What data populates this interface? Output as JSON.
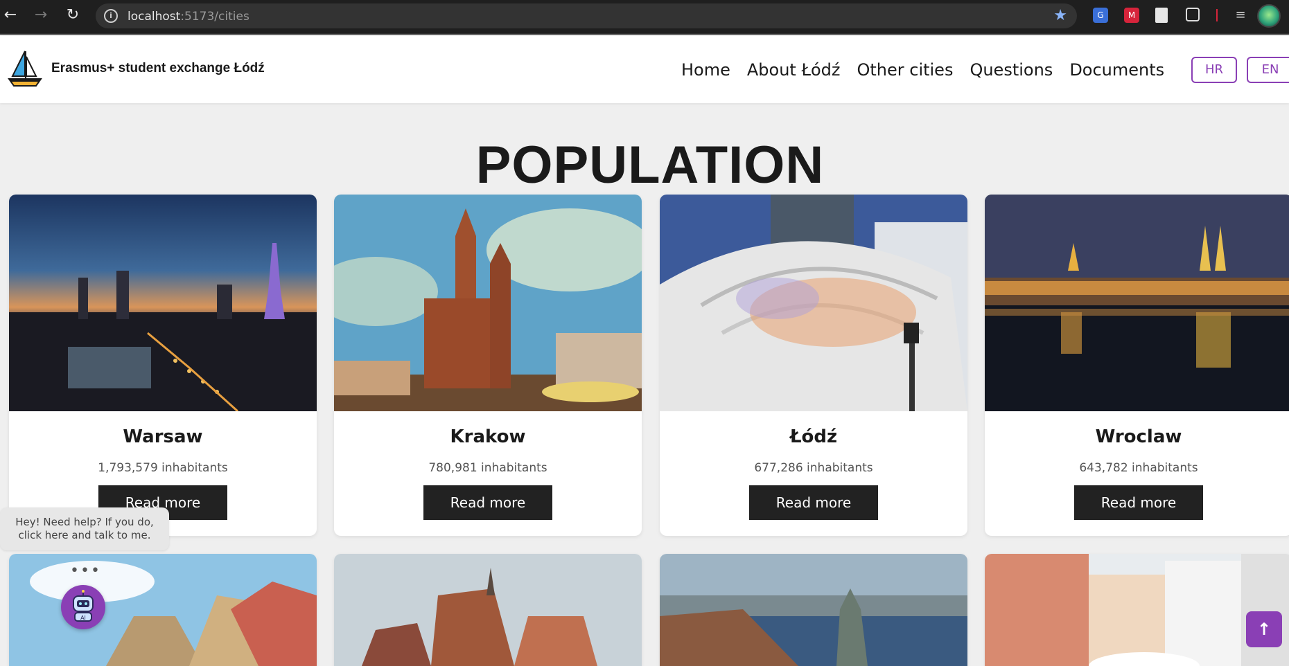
{
  "browser": {
    "url_host": "localhost",
    "url_path": ":5173/cities",
    "back_icon": "arrow-left-icon",
    "forward_icon": "arrow-right-icon",
    "reload_icon": "reload-icon"
  },
  "header": {
    "brand": "Erasmus+ student exchange Łódź",
    "nav": [
      "Home",
      "About Łódź",
      "Other cities",
      "Questions",
      "Documents"
    ],
    "lang_buttons": [
      "HR",
      "EN"
    ],
    "accent_color": "#8a3fb5"
  },
  "page": {
    "title": "POPULATION"
  },
  "cities": [
    {
      "name": "Warsaw",
      "population": "1,793,579 inhabitants",
      "button": "Read more"
    },
    {
      "name": "Krakow",
      "population": "780,981 inhabitants",
      "button": "Read more"
    },
    {
      "name": "Łódź",
      "population": "677,286 inhabitants",
      "button": "Read more"
    },
    {
      "name": "Wroclaw",
      "population": "643,782 inhabitants",
      "button": "Read more"
    }
  ],
  "help": {
    "bubble_line1": "Hey! Need help? If you do,",
    "bubble_line2": "click here and talk to me.",
    "dots": "•••",
    "assistant_label": "AI"
  },
  "scroll_top": {
    "icon": "arrow-up-icon",
    "glyph": "↑"
  }
}
